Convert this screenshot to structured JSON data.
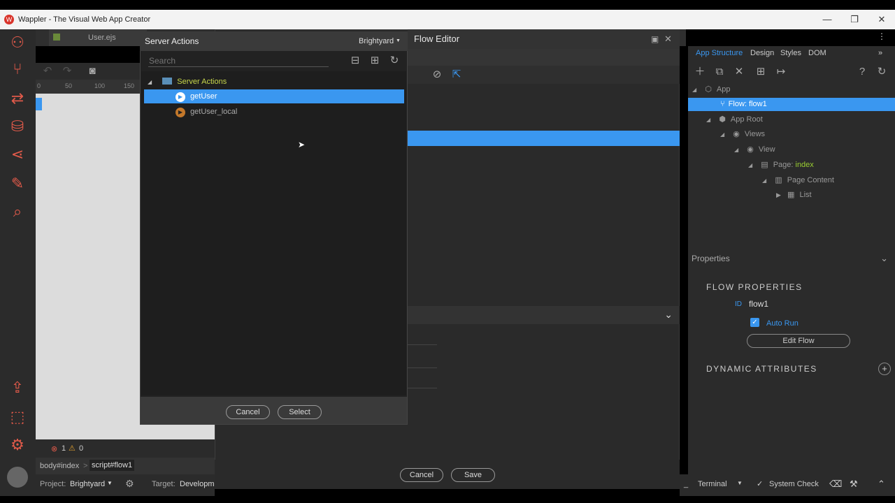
{
  "window": {
    "title": "Wappler - The Visual Web App Creator",
    "logo_icon": "wappler-logo-icon"
  },
  "editor_tabs": [
    {
      "label": "User.ejs"
    }
  ],
  "designer": {
    "ruler_ticks": [
      "0",
      "50",
      "100",
      "150"
    ],
    "errors": "1",
    "warnings": "0",
    "breadcrumb": [
      "body#index",
      "script#flow1"
    ],
    "project_label": "Project:",
    "project_value": "Brightyard",
    "target_label": "Target:",
    "target_value": "Developm"
  },
  "server_actions_dialog": {
    "title": "Server Actions",
    "target": "Brightyard",
    "search_placeholder": "Search",
    "folder": "Server Actions",
    "items": [
      {
        "label": "getUser",
        "selected": true
      },
      {
        "label": "getUser_local",
        "selected": false
      }
    ],
    "cancel_label": "Cancel",
    "select_label": "Select"
  },
  "flow_editor": {
    "title": "Flow Editor",
    "cancel_label": "Cancel",
    "save_label": "Save"
  },
  "right_panel": {
    "tabs": [
      "App Structure",
      "Design",
      "Styles",
      "DOM"
    ],
    "active_tab": "App Structure",
    "tree": [
      {
        "label": "App"
      },
      {
        "label": "Flow: flow1"
      },
      {
        "label": "App Root"
      },
      {
        "label": "Views"
      },
      {
        "label": "View"
      },
      {
        "label_prefix": "Page: ",
        "label_value": "index"
      },
      {
        "label": "Page Content"
      },
      {
        "label": "List"
      }
    ],
    "properties_title": "Properties",
    "flow_properties_title": "FLOW PROPERTIES",
    "id_label": "ID",
    "id_value": "flow1",
    "auto_run_label": "Auto Run",
    "auto_run_checked": true,
    "edit_flow_label": "Edit Flow",
    "dynamic_attributes_title": "DYNAMIC ATTRIBUTES"
  },
  "status_bar": {
    "terminal_label": "Terminal",
    "system_check_label": "System Check"
  },
  "colors": {
    "accent": "#3a97f0",
    "folder_label": "#c8d84a",
    "brand_red": "#e05a4a",
    "page_index_green": "#9acd32"
  }
}
